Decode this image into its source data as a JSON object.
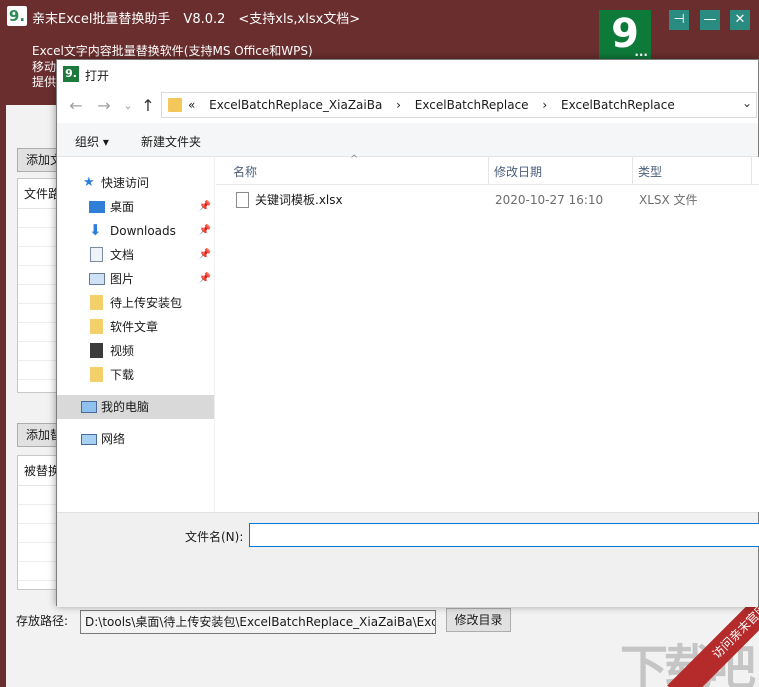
{
  "app": {
    "title": "亲末Excel批量替换助手　V8.0.2　<支持xls,xlsx文档>",
    "logo_small": "9.",
    "brand_logo": "9",
    "brand_logo_dots": "...",
    "subtitle": "Excel文字内容批量替换软件(支持MS Office和WPS)",
    "subtitle2": "移动",
    "subtitle3": "提供",
    "pin_icon": "⊣",
    "minimize_icon": "—",
    "close_icon": "✕",
    "add_file_button": "添加文",
    "file_list_header": "文件路",
    "add_replace_button": "添加替",
    "replace_list_header": "被替换",
    "save_path_label": "存放路径:",
    "save_path_value": "D:\\tools\\桌面\\待上传安装包\\ExcelBatchReplace_XiaZaiBa\\ExcelBa",
    "modify_dir_button": "修改目录"
  },
  "dialog": {
    "title": "打开",
    "title_icon": "9.",
    "address": {
      "prefix": "«",
      "crumbs": [
        "ExcelBatchReplace_XiaZaiBa",
        "ExcelBatchReplace",
        "ExcelBatchReplace"
      ],
      "separator": "›"
    },
    "nav_icons": {
      "back": "←",
      "forward": "→",
      "recent": "⌄",
      "up": "↑",
      "chevron": "⌄"
    },
    "commands": {
      "organize": "组织 ▾",
      "new_folder": "新建文件夹"
    },
    "nav_pane": {
      "quick_access": "快速访问",
      "items": [
        {
          "label": "桌面",
          "pinned": true
        },
        {
          "label": "Downloads",
          "pinned": true
        },
        {
          "label": "文档",
          "pinned": true
        },
        {
          "label": "图片",
          "pinned": true
        },
        {
          "label": "待上传安装包",
          "pinned": false
        },
        {
          "label": "软件文章",
          "pinned": false
        },
        {
          "label": "视频",
          "pinned": false
        },
        {
          "label": "下载",
          "pinned": false
        }
      ],
      "this_pc": "我的电脑",
      "network": "网络"
    },
    "columns": {
      "name": "名称",
      "modified": "修改日期",
      "type": "类型"
    },
    "files": [
      {
        "name": "关键词模板.xlsx",
        "modified": "2020-10-27 16:10",
        "type": "XLSX 文件"
      }
    ],
    "filename_label": "文件名(N):",
    "filename_value": ""
  },
  "watermark": {
    "ribbon": "访问亲末官网",
    "text": "下载吧"
  },
  "colors": {
    "app_bg": "#6a2e2e",
    "accent_teal": "#2a8b80",
    "brand_green": "#0e7a3a",
    "focus_blue": "#0078d7",
    "ribbon_red": "#b52b2b"
  }
}
